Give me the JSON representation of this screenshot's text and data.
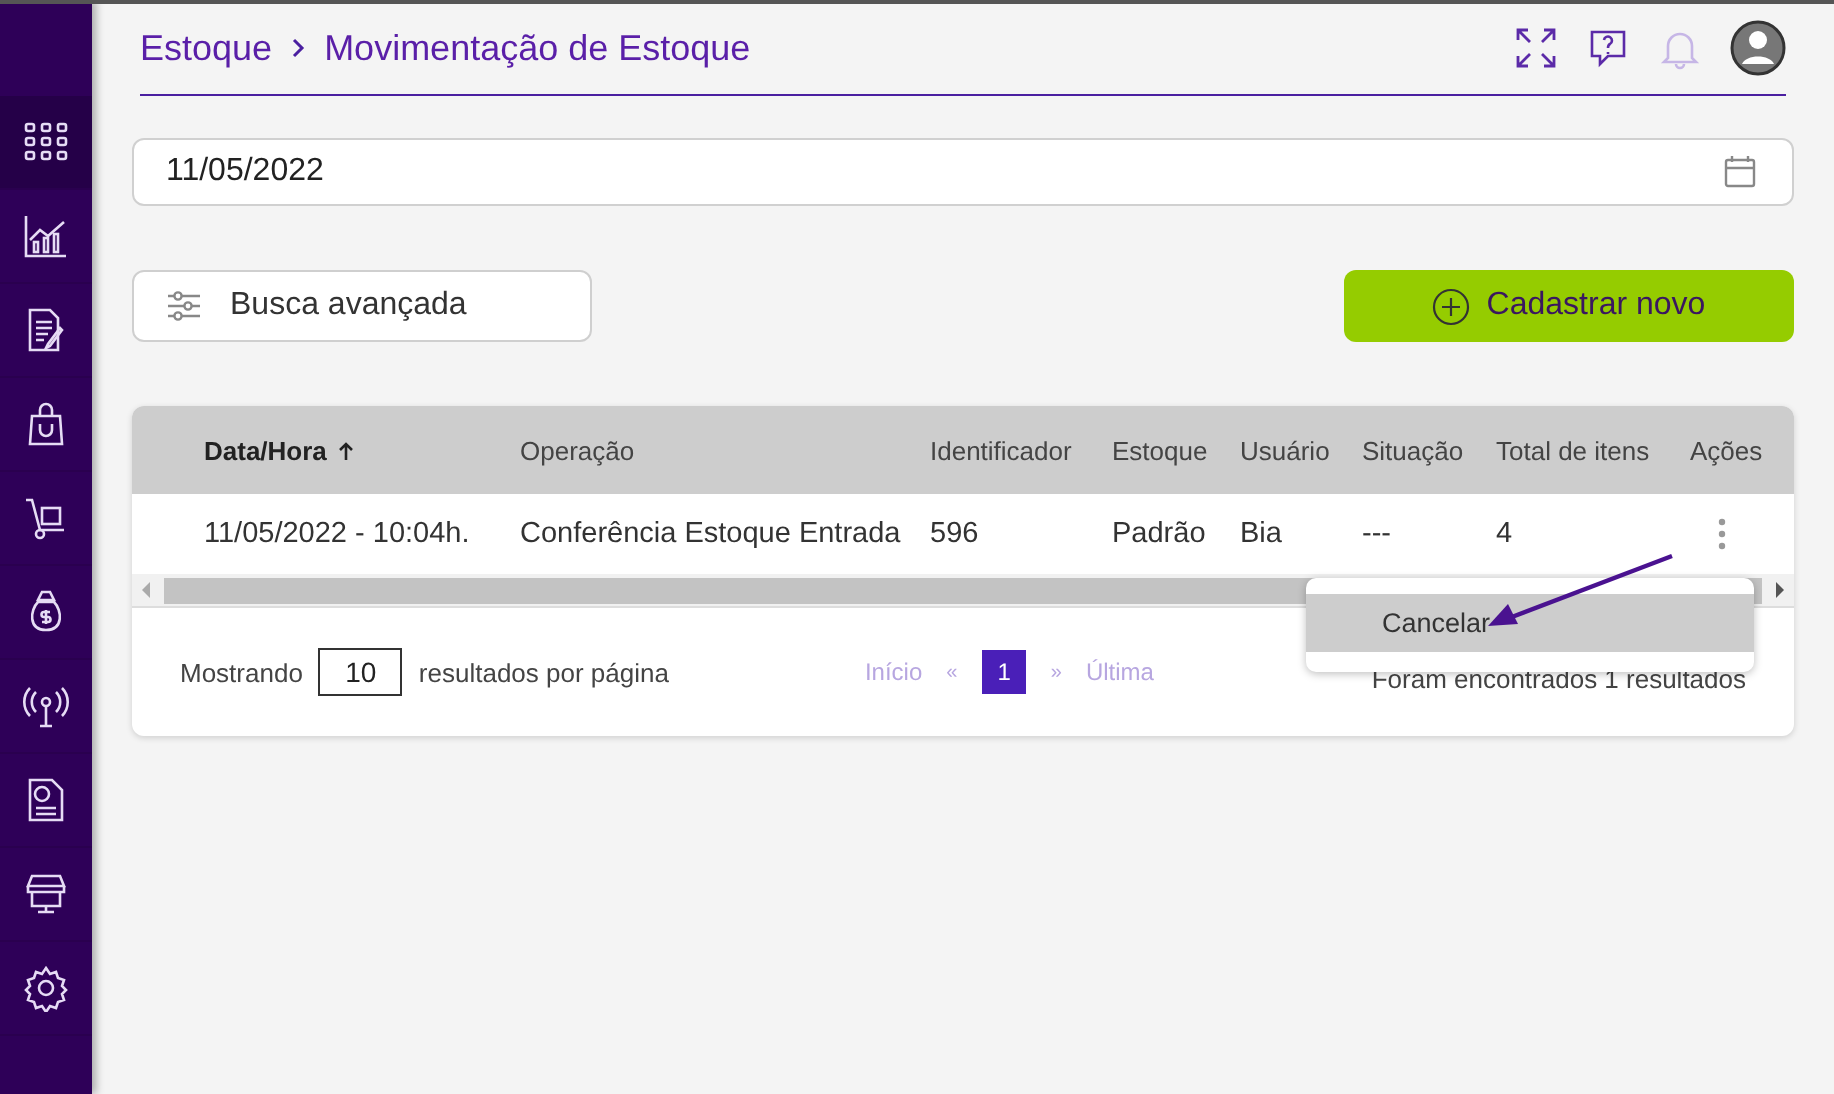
{
  "sidebar": {
    "items": [
      {
        "selected": true
      },
      {
        "selected": false
      },
      {
        "selected": false
      },
      {
        "selected": false
      },
      {
        "selected": false
      },
      {
        "selected": false
      },
      {
        "selected": false
      },
      {
        "selected": false
      },
      {
        "selected": false
      },
      {
        "selected": false
      }
    ]
  },
  "breadcrumb": [
    {
      "label": "Estoque"
    },
    {
      "label": "Movimentação de Estoque"
    }
  ],
  "date_field": {
    "value": "11/05/2022"
  },
  "buttons": {
    "advanced_search": "Busca avançada",
    "create": "Cadastrar novo"
  },
  "table": {
    "columns": [
      {
        "label": "Data/Hora",
        "sorted": true
      },
      {
        "label": "Operação",
        "sorted": false
      },
      {
        "label": "Identificador",
        "sorted": false
      },
      {
        "label": "Estoque",
        "sorted": false
      },
      {
        "label": "Usuário",
        "sorted": false
      },
      {
        "label": "Situação",
        "sorted": false
      },
      {
        "label": "Total de itens",
        "sorted": false
      },
      {
        "label": "Ações",
        "sorted": false
      }
    ],
    "rows": [
      {
        "cells": [
          "11/05/2022 - 10:04h.",
          "Conferência Estoque Entrada",
          "596",
          "Padrão",
          "Bia",
          "---",
          "4"
        ]
      }
    ]
  },
  "context_menu": {
    "items": [
      {
        "label": "Cancelar",
        "selected": true
      }
    ]
  },
  "footer": {
    "showing_label": "Mostrando",
    "page_size": "10",
    "per_page_label": "resultados por página",
    "pagination": {
      "first": "Início",
      "prev": "«",
      "pages": [
        {
          "label": "1",
          "selected": true
        }
      ],
      "next": "»",
      "last": "Última"
    },
    "results": "Foram encontrados 1 resultados"
  }
}
